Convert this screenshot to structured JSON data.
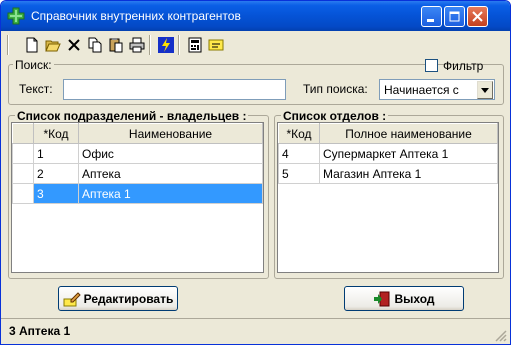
{
  "window": {
    "title": "Справочник внутренних контрагентов",
    "icon": "green-plus-icon"
  },
  "toolbar": {
    "buttons": [
      {
        "name": "new-document-icon"
      },
      {
        "name": "open-folder-icon"
      },
      {
        "name": "delete-icon"
      },
      {
        "name": "copy-icon"
      },
      {
        "name": "paste-icon"
      },
      {
        "name": "print-icon"
      },
      {
        "name": "lightning-icon"
      },
      {
        "name": "calculator-icon"
      },
      {
        "name": "note-icon"
      }
    ]
  },
  "search": {
    "legend": "Поиск:",
    "filter_label": "Фильтр",
    "filter_checked": false,
    "text_label": "Текст:",
    "text_value": "",
    "type_label": "Тип поиска:",
    "type_value": "Начинается с"
  },
  "owners": {
    "title": "Список подразделений - владельцев :",
    "columns": [
      "*Код",
      "Наименование"
    ],
    "rows": [
      {
        "code": "1",
        "name": "Офис"
      },
      {
        "code": "2",
        "name": "Аптека"
      },
      {
        "code": "3",
        "name": "Аптека 1"
      }
    ],
    "selected_index": 2
  },
  "departments": {
    "title": "Список отделов :",
    "columns": [
      "*Код",
      "Полное наименование"
    ],
    "rows": [
      {
        "code": "4",
        "name": "Супермаркет Аптека 1"
      },
      {
        "code": "5",
        "name": "Магазин Аптека 1"
      }
    ]
  },
  "buttons": {
    "edit_label": "Редактировать",
    "exit_label": "Выход"
  },
  "status": {
    "text": "3 Аптека 1"
  },
  "colors": {
    "selection": "#3399ff",
    "titlebar": "#0553d6",
    "window_bg": "#ece9d8"
  }
}
